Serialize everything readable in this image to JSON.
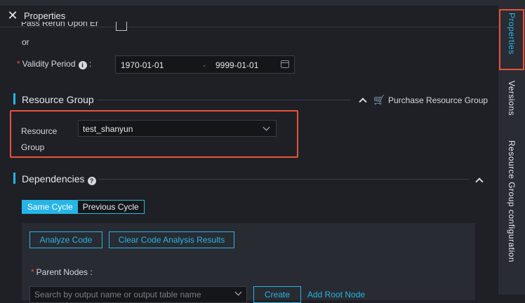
{
  "header": {
    "title": "Properties"
  },
  "misc": {
    "cut_label": "Pass Rerun Upon Er",
    "or_label": "or"
  },
  "validity": {
    "required_mark": "*",
    "label": "Validity Period",
    "info_glyph": "i",
    "colon": ":",
    "start": "1970-01-01",
    "separator": "-",
    "end": "9999-01-01"
  },
  "resource_group": {
    "section_title": "Resource Group",
    "purchase_label": "Purchase Resource Group",
    "field_label": "Resource Group",
    "selected": "test_shanyun"
  },
  "dependencies": {
    "section_title": "Dependencies",
    "help_glyph": "?",
    "cycle_tabs": [
      "Same Cycle",
      "Previous Cycle"
    ],
    "analyze_button": "Analyze Code",
    "clear_button": "Clear Code Analysis Results",
    "parent_nodes_label": "Parent Nodes :",
    "search_placeholder": "Search by output name or output table name",
    "create_button": "Create",
    "add_root_node": "Add Root Node"
  },
  "sidebar": {
    "tabs": [
      "Properties",
      "Versions",
      "Resource Group configuration"
    ]
  },
  "colors": {
    "accent": "#26b5e6",
    "highlight": "#e8533a",
    "required": "#ea4f3f"
  },
  "icons": [
    "close-icon",
    "info-icon",
    "calendar-icon",
    "chevron-up-icon",
    "cart-icon",
    "chevron-down-icon",
    "help-icon"
  ]
}
